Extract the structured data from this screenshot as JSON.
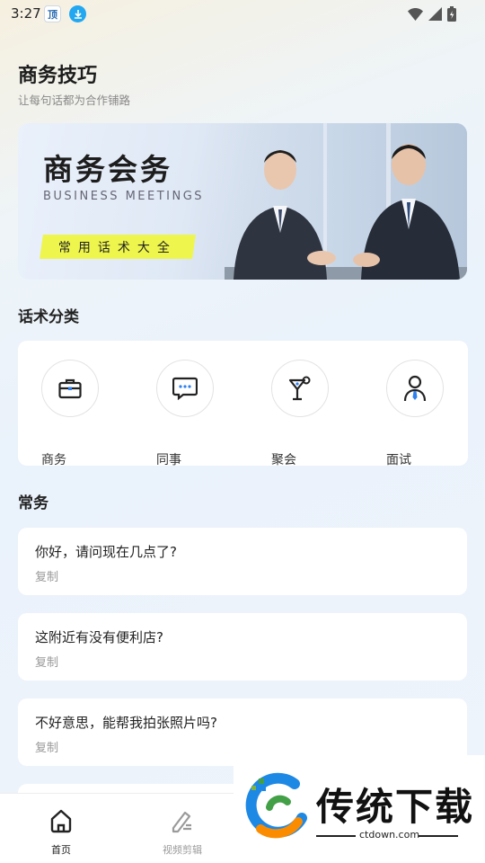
{
  "status_bar": {
    "time": "3:27",
    "app_icon_1": "顶",
    "app_icon_2": "download-arrow-icon",
    "right_icons": [
      "wifi-icon",
      "signal-icon",
      "battery-charging-icon"
    ]
  },
  "header": {
    "title": "商务技巧",
    "subtitle": "让每句话都为合作铺路"
  },
  "banner": {
    "title": "商务会务",
    "subtitle_en": "BUSINESS MEETINGS",
    "tag": "常用话术大全"
  },
  "categories": {
    "title": "话术分类",
    "items": [
      {
        "label": "商务",
        "icon": "briefcase-icon"
      },
      {
        "label": "同事",
        "icon": "chat-bubble-icon"
      },
      {
        "label": "聚会",
        "icon": "cocktail-icon"
      },
      {
        "label": "面试",
        "icon": "person-tie-icon"
      }
    ]
  },
  "phrases": {
    "title": "常务",
    "items": [
      {
        "text": "你好，请问现在几点了?",
        "action": "复制"
      },
      {
        "text": "这附近有没有便利店?",
        "action": "复制"
      },
      {
        "text": "不好意思，能帮我拍张照片吗?",
        "action": "复制"
      }
    ]
  },
  "tab_bar": {
    "tabs": [
      {
        "label": "首页",
        "icon": "home-icon",
        "active": true
      },
      {
        "label": "视频剪辑",
        "icon": "edit-pen-icon",
        "active": false
      }
    ]
  },
  "watermark": {
    "text": "传统下载",
    "url": "ctdown.com"
  },
  "colors": {
    "accent_yellow": "#eef54c",
    "active_tab": "#222222",
    "inactive_tab": "#999999",
    "logo_blue": "#1e88e5",
    "logo_green": "#43a047",
    "logo_orange": "#fb8c00"
  }
}
